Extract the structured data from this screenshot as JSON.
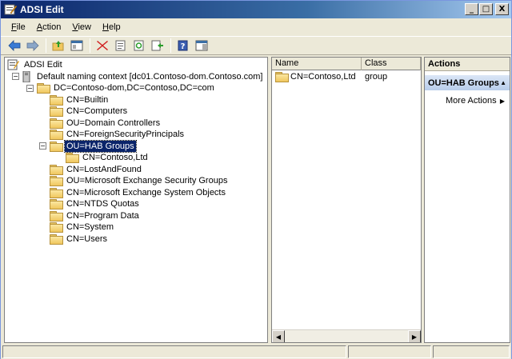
{
  "window": {
    "title": "ADSI Edit",
    "controls": {
      "minimize": "_",
      "maximize": "□",
      "close": "X"
    }
  },
  "menu": [
    {
      "label": "File",
      "accel": "F",
      "rest": "ile"
    },
    {
      "label": "Action",
      "accel": "A",
      "rest": "ction"
    },
    {
      "label": "View",
      "accel": "V",
      "rest": "iew"
    },
    {
      "label": "Help",
      "accel": "H",
      "rest": "elp"
    }
  ],
  "toolbar": {
    "icons": [
      "back-arrow-icon",
      "forward-arrow-icon",
      "up-folder-icon",
      "show-hide-tree-icon",
      "delete-icon",
      "properties-icon",
      "refresh-icon",
      "export-list-icon",
      "help-icon",
      "show-hide-action-pane-icon"
    ]
  },
  "tree": {
    "root": "ADSI Edit",
    "context": "Default naming context [dc01.Contoso-dom.Contoso.com]",
    "domain": "DC=Contoso-dom,DC=Contoso,DC=com",
    "children": [
      "CN=Builtin",
      "CN=Computers",
      "OU=Domain Controllers",
      "CN=ForeignSecurityPrincipals",
      "OU=HAB Groups",
      "CN=Contoso,Ltd",
      "CN=LostAndFound",
      "OU=Microsoft Exchange Security Groups",
      "CN=Microsoft Exchange System Objects",
      "CN=NTDS Quotas",
      "CN=Program Data",
      "CN=System",
      "CN=Users"
    ],
    "expander_minus": "−"
  },
  "list": {
    "columns": {
      "name": "Name",
      "class": "Class"
    },
    "rows": [
      {
        "name": "CN=Contoso,Ltd",
        "class": "group"
      }
    ],
    "scroll_left": "◀",
    "scroll_right": "▶"
  },
  "actions": {
    "title": "Actions",
    "section": "OU=HAB Groups",
    "section_arrow": "▲",
    "more": "More Actions",
    "more_arrow": "▶"
  },
  "colors": {
    "selection": "#0a246a",
    "titlebar": "#0a246a",
    "actions_section": "#b8cdeb"
  }
}
